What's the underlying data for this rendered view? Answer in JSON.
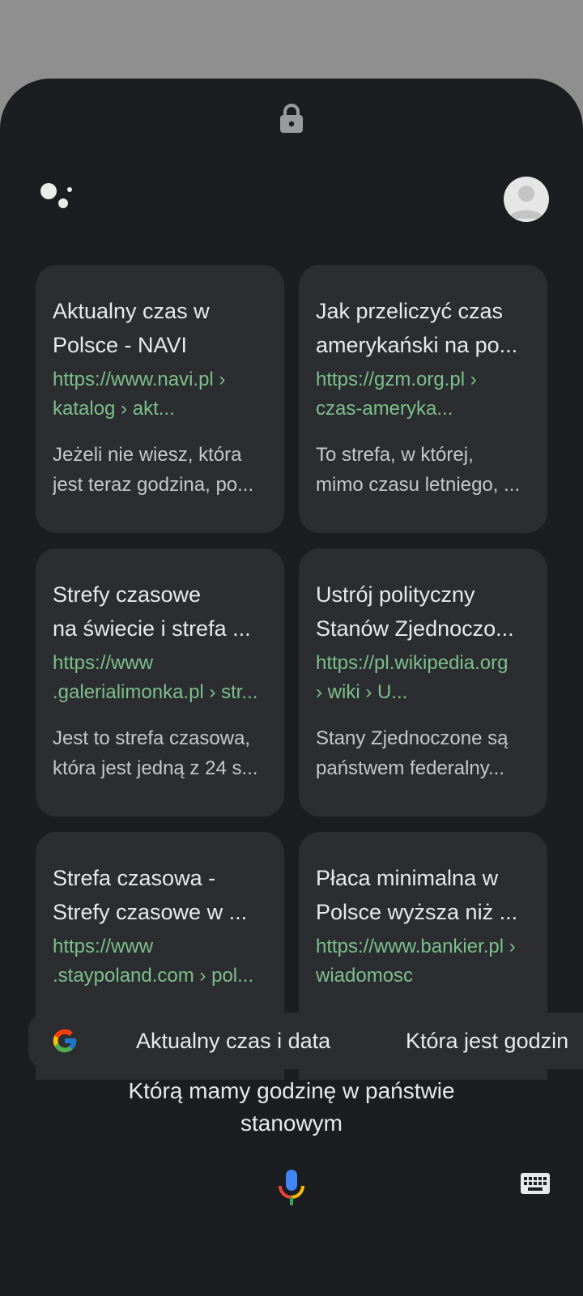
{
  "icons": {
    "lock": "lock-icon",
    "assistant": "google-assistant-icon",
    "avatar": "account-avatar",
    "google": "google-g-icon",
    "mic": "microphone-icon",
    "keyboard": "keyboard-icon"
  },
  "results": [
    {
      "title": [
        "Aktualny czas w",
        "Polsce - NAVI"
      ],
      "url": [
        "https://www.navi.pl ›",
        "katalog › akt..."
      ],
      "snippet": [
        "Jeżeli nie wiesz, która",
        "jest teraz godzina, po..."
      ]
    },
    {
      "title": [
        "Jak przeliczyć czas",
        "amerykański na po..."
      ],
      "url": [
        "https://gzm.org.pl ›",
        "czas-ameryka..."
      ],
      "snippet": [
        "To strefa, w której,",
        "mimo czasu letniego, ..."
      ]
    },
    {
      "title": [
        "Strefy czasowe",
        "na świecie i strefa ..."
      ],
      "url": [
        "https://www",
        ".galerialimonka.pl › str..."
      ],
      "snippet": [
        "Jest to strefa czasowa,",
        "która jest jedną z 24 s..."
      ]
    },
    {
      "title": [
        "Ustrój polityczny",
        "Stanów Zjednoczo..."
      ],
      "url": [
        "https://pl.wikipedia.org",
        "› wiki › U..."
      ],
      "snippet": [
        "Stany Zjednoczone są",
        "państwem federalny..."
      ]
    },
    {
      "title": [
        "Strefa czasowa -",
        "Strefy czasowe w ..."
      ],
      "url": [
        "https://www",
        ".staypoland.com › pol..."
      ],
      "snippet": [
        "",
        ""
      ]
    },
    {
      "title": [
        "Płaca minimalna w",
        "Polsce wyższa niż ..."
      ],
      "url": [
        "https://www.bankier.pl ›",
        "wiadomosc"
      ],
      "snippet": [
        "",
        ""
      ]
    }
  ],
  "chips": [
    "Aktualny czas i data",
    "Która jest godzin"
  ],
  "query": [
    "Którą mamy godzinę w państwie",
    "stanowym"
  ],
  "colors": {
    "background": "#1b1d20",
    "card": "#2b2d31",
    "url_green": "#7dbf8b",
    "scrim": "#8f8f8f"
  }
}
